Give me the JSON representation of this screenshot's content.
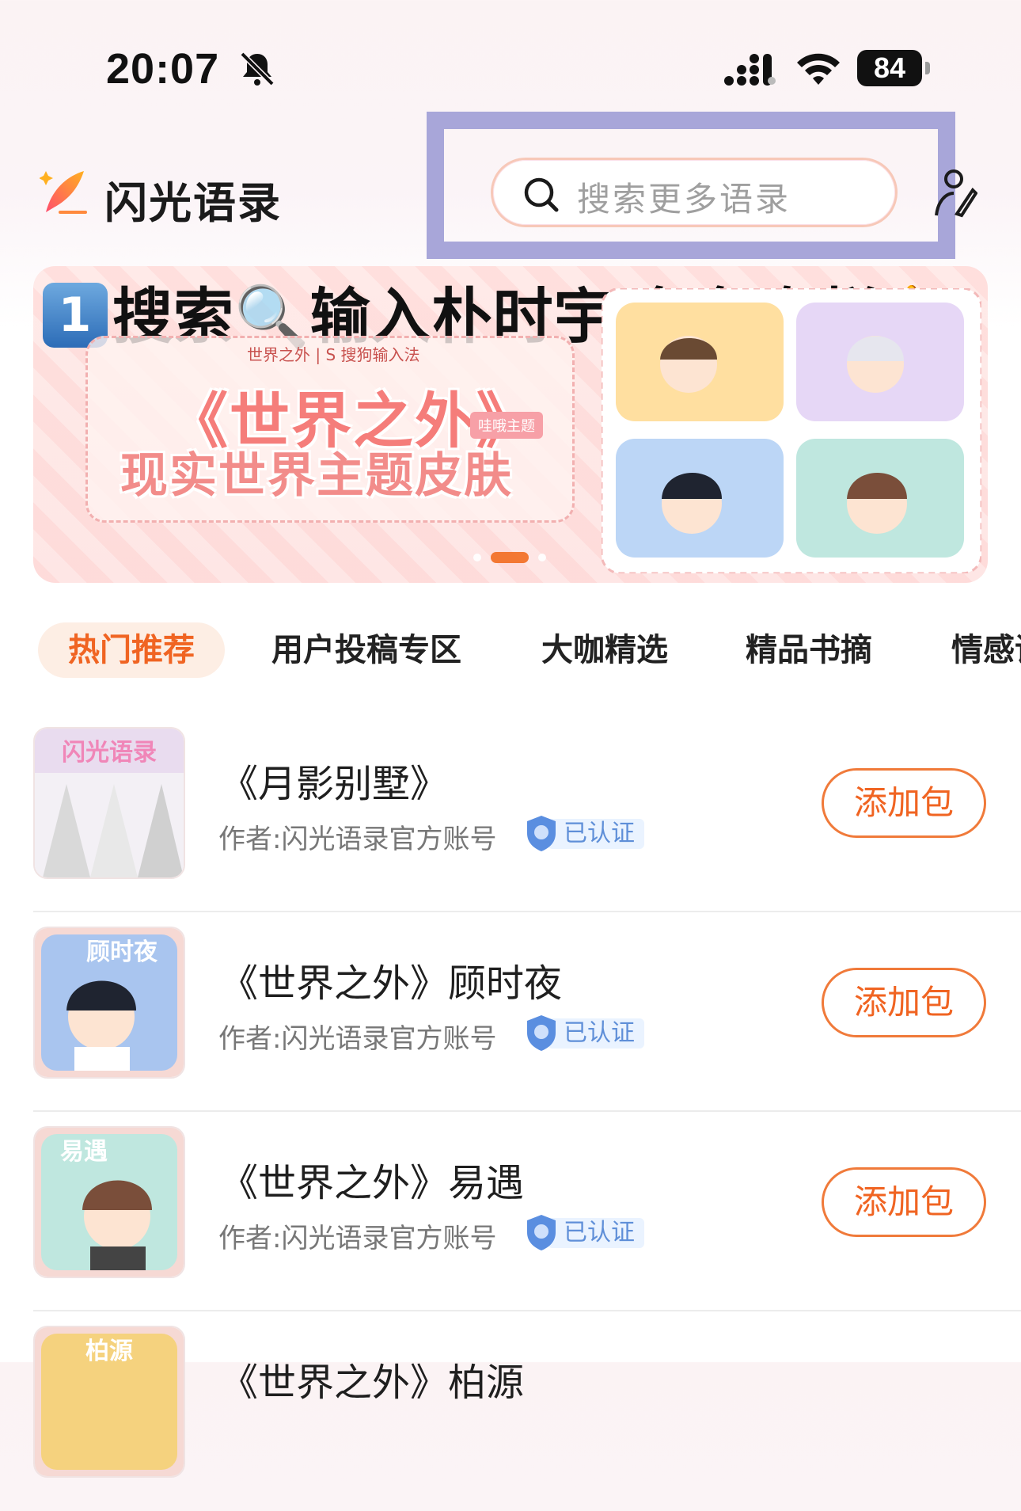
{
  "status_bar": {
    "time": "20:07",
    "battery": "84",
    "icons": [
      "bell-slash-icon",
      "signal-icon",
      "wifi-icon",
      "battery-icon"
    ]
  },
  "header": {
    "title": "闪光语录",
    "search_placeholder": "搜索更多语录"
  },
  "banner": {
    "headline_num": "1",
    "headline_text": "搜索🔍输入朴时宇/兔兔专栏👆",
    "brand": "世界之外 | S 搜狗输入法",
    "title": "《世界之外》",
    "tag": "哇哦主题",
    "subtitle": "现实世界主题皮肤",
    "active_slide": 2,
    "slide_count": 3
  },
  "tabs": [
    {
      "label": "热门推荐",
      "active": true
    },
    {
      "label": "用户投稿专区",
      "active": false
    },
    {
      "label": "大咖精选",
      "active": false
    },
    {
      "label": "精品书摘",
      "active": false
    },
    {
      "label": "情感语",
      "active": false
    }
  ],
  "items": [
    {
      "title": "《月影别墅》",
      "author": "作者:闪光语录官方账号",
      "badge": "已认证",
      "button": "添加包",
      "thumb_text": "闪光语录"
    },
    {
      "title": "《世界之外》顾时夜",
      "author": "作者:闪光语录官方账号",
      "badge": "已认证",
      "button": "添加包",
      "thumb_text": "顾时夜"
    },
    {
      "title": "《世界之外》易遇",
      "author": "作者:闪光语录官方账号",
      "badge": "已认证",
      "button": "添加包",
      "thumb_text": "易遇"
    },
    {
      "title": "《世界之外》柏源",
      "author": "",
      "badge": "",
      "button": "",
      "thumb_text": "柏源"
    }
  ],
  "colors": {
    "accent": "#f06422",
    "tab_active_bg": "#fdeee4",
    "highlight": "#a8a6d9",
    "verified_bg": "#eaf3ff"
  }
}
